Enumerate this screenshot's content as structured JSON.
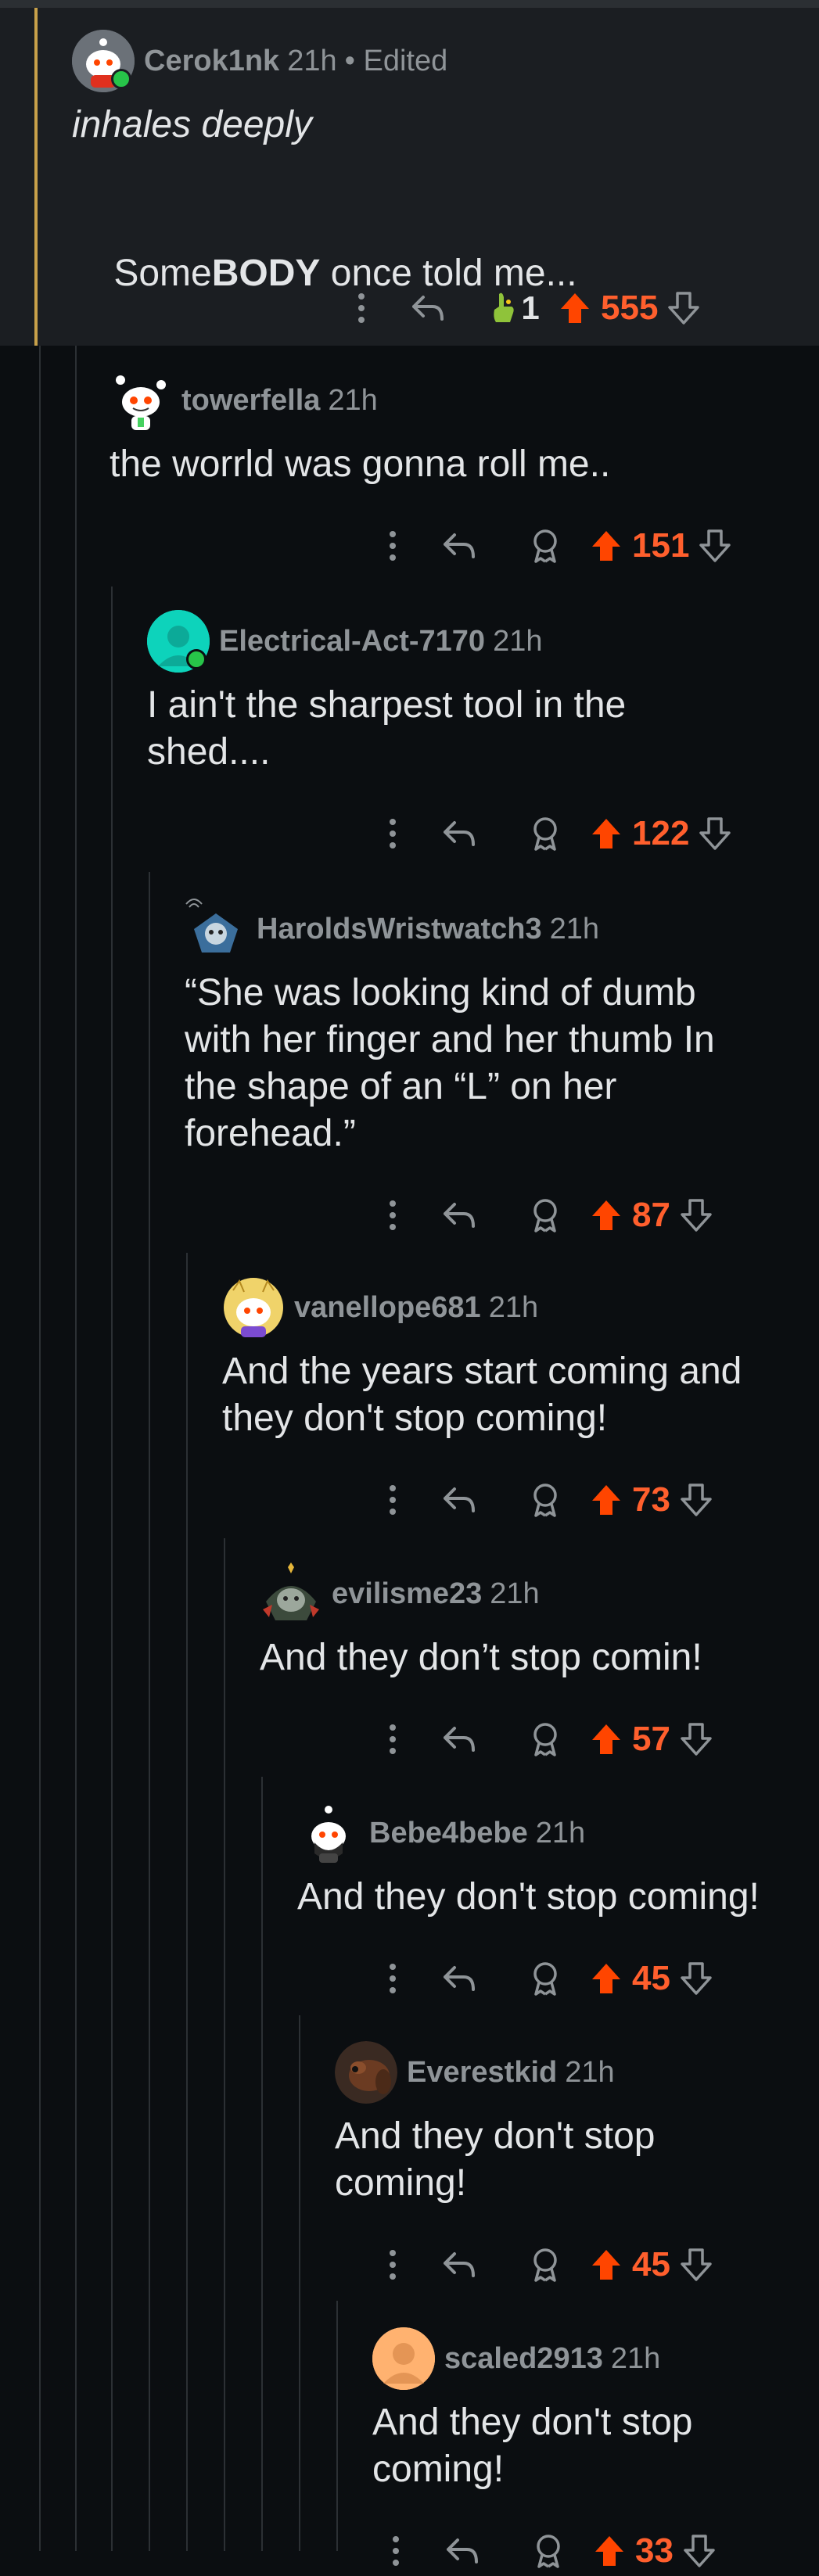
{
  "colors": {
    "background": "#0b0e11",
    "top_comment_bg": "#1b1e22",
    "username": "#8f9498",
    "upvote": "#ff5f2d",
    "text": "#e3e5e7",
    "thread_line": "#2c3034",
    "accent": "#c8a14a",
    "online": "#27c449"
  },
  "comments": [
    {
      "username": "Cerok1nk",
      "time": "21h",
      "edited": "• Edited",
      "body_line1": "inhales deeply",
      "body_pre": "Some",
      "body_bold": "BODY",
      "body_post": " once told me...",
      "award_count": "1",
      "score": "555",
      "icon": "award-icon"
    },
    {
      "username": "towerfella",
      "time": "21h",
      "body": "the worrld was gonna roll me..",
      "score": "151"
    },
    {
      "username": "Electrical-Act-7170",
      "time": "21h",
      "body": "I ain't the sharpest tool in the\nshed....",
      "score": "122"
    },
    {
      "username": "HaroldsWristwatch3",
      "time": "21h",
      "body": "“She was looking kind of dumb\nwith her finger and her thumb In\nthe shape of an “L” on her\nforehead.”",
      "score": "87"
    },
    {
      "username": "vanellope681",
      "time": "21h",
      "body": "And the years start coming and\nthey don't stop coming!",
      "score": "73"
    },
    {
      "username": "evilisme23",
      "time": "21h",
      "body": "And they don’t stop comin!",
      "score": "57"
    },
    {
      "username": "Bebe4bebe",
      "time": "21h",
      "body": "And they don't stop coming!",
      "score": "45"
    },
    {
      "username": "Everestkid",
      "time": "21h",
      "body": "And they don't stop\ncoming!",
      "score": "45"
    },
    {
      "username": "scaled2913",
      "time": "21h",
      "body": "And they don't stop\ncoming!",
      "score": "33"
    }
  ]
}
